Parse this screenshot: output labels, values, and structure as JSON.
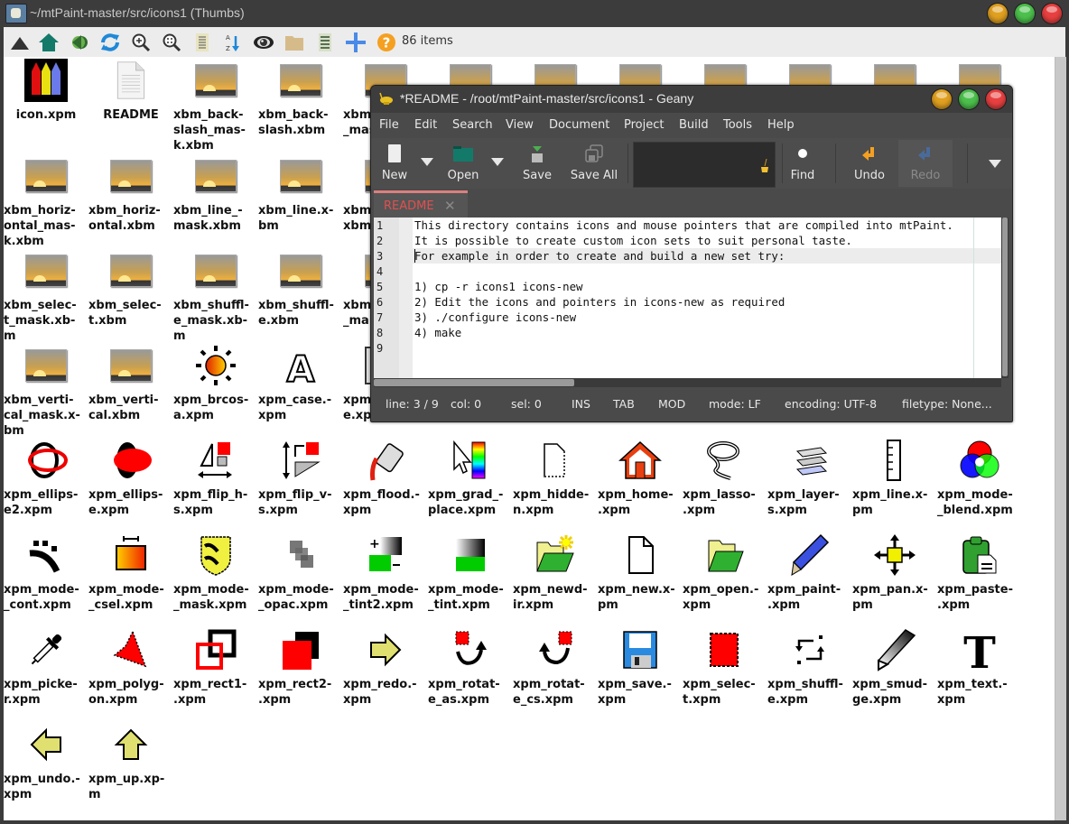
{
  "file_manager": {
    "title": "~/mtPaint-master/src/icons1 (Thumbs)",
    "toolbar": {
      "buttons": [
        {
          "name": "up-arrow-icon",
          "tooltip": "Up"
        },
        {
          "name": "home-icon",
          "tooltip": "Home"
        },
        {
          "name": "back-icon",
          "tooltip": "Back"
        },
        {
          "name": "refresh-icon",
          "tooltip": "Refresh"
        },
        {
          "name": "zoom-in-icon",
          "tooltip": "Zoom in"
        },
        {
          "name": "zoom-fit-icon",
          "tooltip": "Zoom"
        },
        {
          "name": "list-view-icon",
          "tooltip": "List"
        },
        {
          "name": "sort-az-icon",
          "tooltip": "Sort"
        },
        {
          "name": "eye-icon",
          "tooltip": "Show hidden"
        },
        {
          "name": "folder-icon",
          "tooltip": "Folder"
        },
        {
          "name": "details-icon",
          "tooltip": "Details"
        },
        {
          "name": "plus-icon",
          "tooltip": "New"
        },
        {
          "name": "help-icon",
          "tooltip": "Help"
        }
      ],
      "items_count": "86 items"
    },
    "files": [
      {
        "label": "icon.xpm",
        "icon": "pencils",
        "centered": true
      },
      {
        "label": "README",
        "icon": "document",
        "centered": true
      },
      {
        "label": "xbm_back-\nslash_mas-\nk.xbm",
        "icon": "image"
      },
      {
        "label": "xbm_back-\nslash.xbm",
        "icon": "image"
      },
      {
        "label": "xbm\n_mas",
        "icon": "image"
      },
      {
        "label": "",
        "icon": "image"
      },
      {
        "label": "",
        "icon": "image"
      },
      {
        "label": "",
        "icon": "image"
      },
      {
        "label": "",
        "icon": "image"
      },
      {
        "label": "",
        "icon": "image"
      },
      {
        "label": "",
        "icon": "image"
      },
      {
        "label": "",
        "icon": "image"
      },
      {
        "label": "xbm_horiz-\nontal_mas-\nk.xbm",
        "icon": "image"
      },
      {
        "label": "xbm_horiz-\nontal.xbm",
        "icon": "image"
      },
      {
        "label": "xbm_line_-\nmask.xbm",
        "icon": "image"
      },
      {
        "label": "xbm_line.x-\nbm",
        "icon": "image"
      },
      {
        "label": "xbm\nxbm",
        "icon": "image"
      },
      {
        "label": "xbm_selec-\nt_mask.xb-\nm",
        "icon": "image"
      },
      {
        "label": "xbm_selec-\nt.xbm",
        "icon": "image"
      },
      {
        "label": "xbm_shuffl-\ne_mask.xb-\nm",
        "icon": "image"
      },
      {
        "label": "xbm_shuffl-\ne.xbm",
        "icon": "image"
      },
      {
        "label": "xbm\n_ma",
        "icon": "image"
      },
      {
        "label": "xbm_verti-\ncal_mask.x-\nbm",
        "icon": "image"
      },
      {
        "label": "xbm_verti-\ncal.xbm",
        "icon": "image"
      },
      {
        "label": "xpm_brcos-\na.xpm",
        "icon": "sun"
      },
      {
        "label": "xpm_case.-\nxpm",
        "icon": "letter-a"
      },
      {
        "label": "xpm\ne.xp",
        "icon": "box"
      },
      {
        "label": "xpm_ellips-\ne2.xpm",
        "icon": "ellipse-outline"
      },
      {
        "label": "xpm_ellips-\ne.xpm",
        "icon": "ellipse-filled"
      },
      {
        "label": "xpm_flip_h-\ns.xpm",
        "icon": "flip-h"
      },
      {
        "label": "xpm_flip_v-\ns.xpm",
        "icon": "flip-v"
      },
      {
        "label": "xpm_flood.-\nxpm",
        "icon": "flood"
      },
      {
        "label": "xpm_grad_-\nplace.xpm",
        "icon": "gradient"
      },
      {
        "label": "xpm_hidde-\nn.xpm",
        "icon": "hidden"
      },
      {
        "label": "xpm_home-\n.xpm",
        "icon": "house"
      },
      {
        "label": "xpm_lasso-\n.xpm",
        "icon": "lasso"
      },
      {
        "label": "xpm_layer-\ns.xpm",
        "icon": "layers"
      },
      {
        "label": "xpm_line.x-\npm",
        "icon": "ruler"
      },
      {
        "label": "xpm_mode-\n_blend.xpm",
        "icon": "rgb-blend"
      },
      {
        "label": "xpm_mode-\n_cont.xpm",
        "icon": "cont"
      },
      {
        "label": "xpm_mode-\n_csel.xpm",
        "icon": "csel"
      },
      {
        "label": "xpm_mode-\n_mask.xpm",
        "icon": "mask"
      },
      {
        "label": "xpm_mode-\n_opac.xpm",
        "icon": "opac"
      },
      {
        "label": "xpm_mode-\n_tint2.xpm",
        "icon": "tint2"
      },
      {
        "label": "xpm_mode-\n_tint.xpm",
        "icon": "tint"
      },
      {
        "label": "xpm_newd-\nir.xpm",
        "icon": "newdir"
      },
      {
        "label": "xpm_new.x-\npm",
        "icon": "new"
      },
      {
        "label": "xpm_open.-\nxpm",
        "icon": "open"
      },
      {
        "label": "xpm_paint-\n.xpm",
        "icon": "paint"
      },
      {
        "label": "xpm_pan.x-\npm",
        "icon": "pan"
      },
      {
        "label": "xpm_paste-\n.xpm",
        "icon": "paste"
      },
      {
        "label": "xpm_picke-\nr.xpm",
        "icon": "picker"
      },
      {
        "label": "xpm_polyg-\non.xpm",
        "icon": "polygon"
      },
      {
        "label": "xpm_rect1-\n.xpm",
        "icon": "rect1"
      },
      {
        "label": "xpm_rect2-\n.xpm",
        "icon": "rect2"
      },
      {
        "label": "xpm_redo.-\nxpm",
        "icon": "redo"
      },
      {
        "label": "xpm_rotat-\ne_as.xpm",
        "icon": "rotate-as"
      },
      {
        "label": "xpm_rotat-\ne_cs.xpm",
        "icon": "rotate-cs"
      },
      {
        "label": "xpm_save.-\nxpm",
        "icon": "save"
      },
      {
        "label": "xpm_selec-\nt.xpm",
        "icon": "select"
      },
      {
        "label": "xpm_shuffl-\ne.xpm",
        "icon": "shuffle"
      },
      {
        "label": "xpm_smud-\nge.xpm",
        "icon": "smudge"
      },
      {
        "label": "xpm_text.-\nxpm",
        "icon": "text"
      },
      {
        "label": "xpm_undo.-\nxpm",
        "icon": "undo"
      },
      {
        "label": "xpm_up.xp-\nm",
        "icon": "up"
      }
    ]
  },
  "geany": {
    "title": "*README - /root/mtPaint-master/src/icons1 - Geany",
    "menu": [
      "File",
      "Edit",
      "Search",
      "View",
      "Document",
      "Project",
      "Build",
      "Tools",
      "Help"
    ],
    "toolbar": {
      "new": "New",
      "open": "Open",
      "save": "Save",
      "save_all": "Save All",
      "find": "Find",
      "undo": "Undo",
      "redo": "Redo",
      "search_value": ""
    },
    "tab": {
      "label": "README",
      "close": "✕"
    },
    "lines": [
      "This directory contains icons and mouse pointers that are compiled into mtPaint.",
      "It is possible to create custom icon sets to suit personal taste.",
      "For example in order to create and build a new set try:",
      "",
      "1) cp -r icons1 icons-new",
      "2) Edit the icons and pointers in icons-new as required",
      "3) ./configure icons-new",
      "4) make",
      ""
    ],
    "line_numbers": [
      "1",
      "2",
      "3",
      "4",
      "5",
      "6",
      "7",
      "8",
      "9"
    ],
    "status": {
      "line": "line: 3 / 9",
      "col": "col: 0",
      "sel": "sel: 0",
      "ins": "INS",
      "tab": "TAB",
      "mod": "MOD",
      "mode": "mode: LF",
      "encoding": "encoding: UTF-8",
      "filetype": "filetype: None..."
    }
  }
}
